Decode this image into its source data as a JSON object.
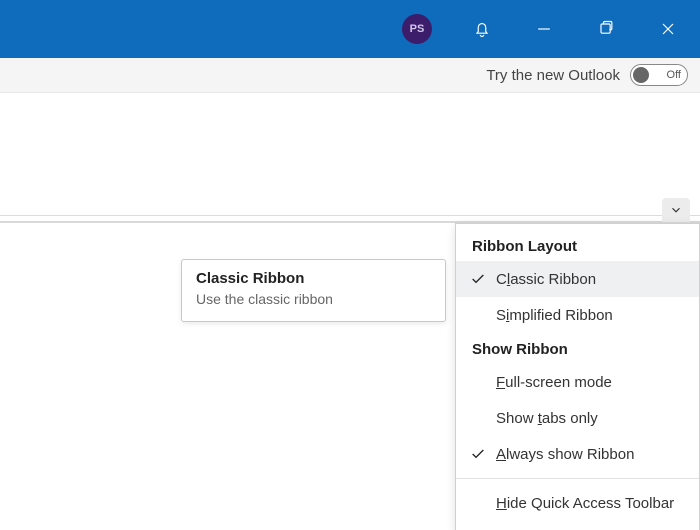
{
  "titlebar": {
    "avatar_initials": "PS"
  },
  "strip": {
    "try_label": "Try the new Outlook",
    "toggle_state": "Off"
  },
  "tooltip": {
    "title": "Classic Ribbon",
    "desc": "Use the classic ribbon"
  },
  "menu": {
    "heading_layout": "Ribbon Layout",
    "item_classic": "Classic Ribbon",
    "item_classic_ul": "l",
    "item_simplified": "Simplified Ribbon",
    "item_simplified_ul": "i",
    "heading_show": "Show Ribbon",
    "item_fullscreen": "Full-screen mode",
    "item_fullscreen_ul": "F",
    "item_tabs": "Show tabs only",
    "item_tabs_ul": "t",
    "item_always": "Always show Ribbon",
    "item_always_ul": "A",
    "item_hideqat": "Hide Quick Access Toolbar",
    "item_hideqat_ul": "H"
  }
}
